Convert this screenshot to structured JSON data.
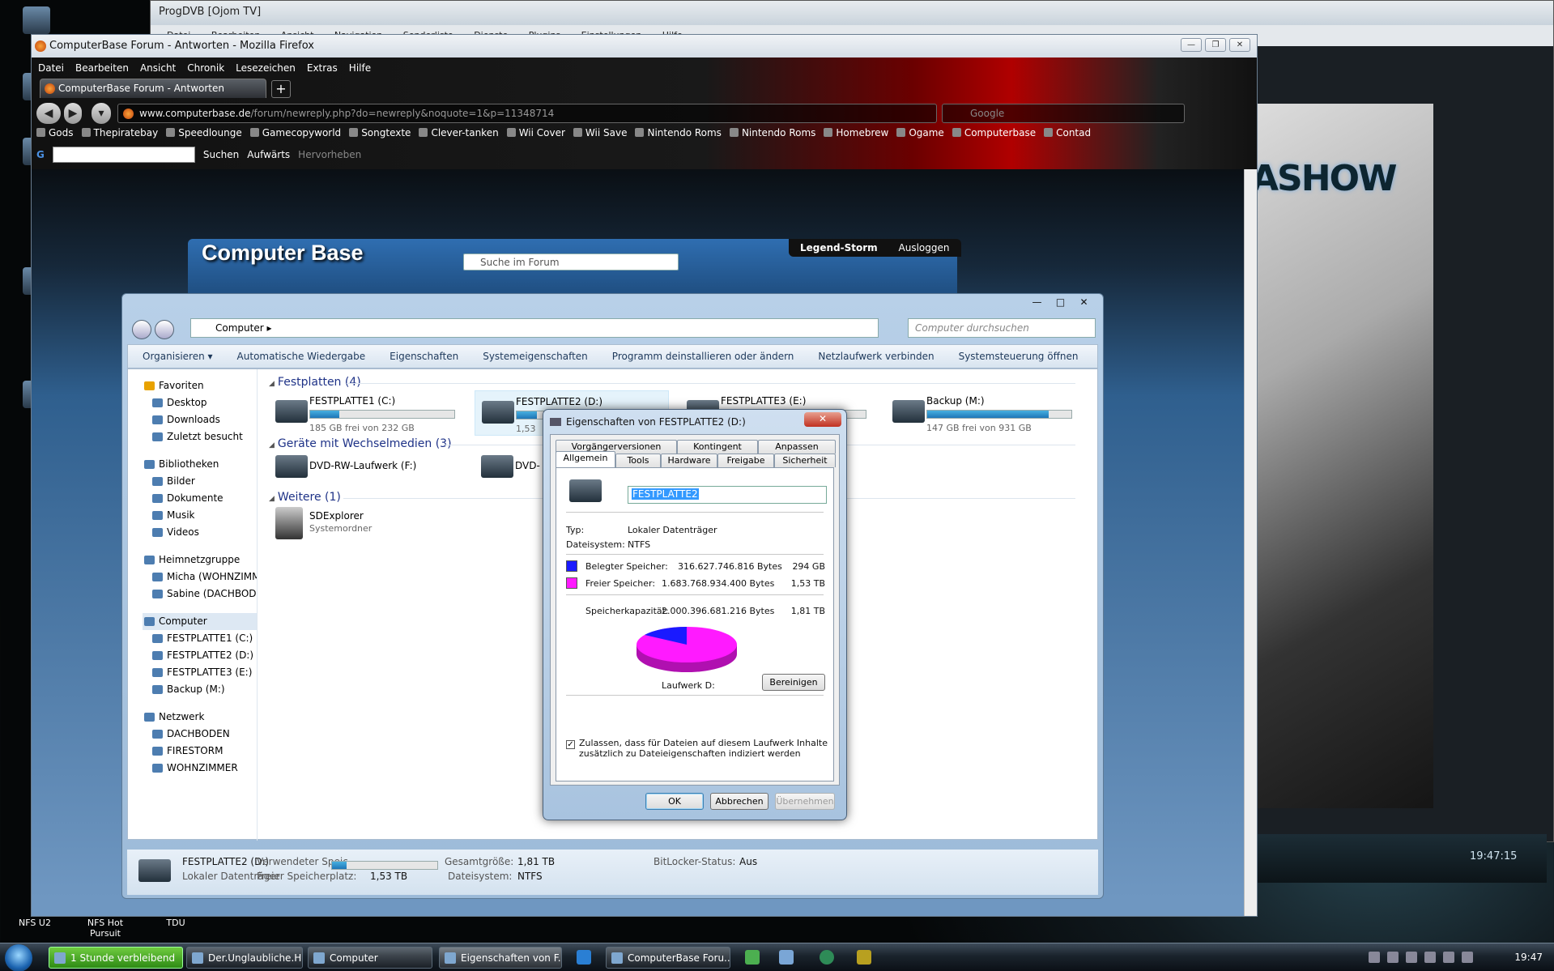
{
  "desktop": {
    "bottom_labels": [
      "NFS U2",
      "NFS Hot Pursuit",
      "TDU"
    ]
  },
  "progdvb": {
    "title": "ProgDVB [Ojom TV]",
    "menu": [
      "Datei",
      "Bearbeiten",
      "Ansicht",
      "Navigation",
      "Senderliste",
      "Dienste",
      "Plugins",
      "Einstellungen",
      "Hilfe"
    ],
    "video_text": "ASHOW",
    "time": "19:47:15"
  },
  "firefox": {
    "title": "ComputerBase Forum - Antworten - Mozilla Firefox",
    "menu": [
      "Datei",
      "Bearbeiten",
      "Ansicht",
      "Chronik",
      "Lesezeichen",
      "Extras",
      "Hilfe"
    ],
    "tab_label": "ComputerBase Forum - Antworten",
    "new_tab": "+",
    "url_domain": "www.computerbase.de",
    "url_path": "/forum/newreply.php?do=newreply&noquote=1&p=11348714",
    "search_placeholder": "Google",
    "bookmarks": [
      "Gods",
      "Thepiratebay",
      "Speedlounge",
      "Gamecopyworld",
      "Songtexte",
      "Clever-tanken",
      "Wii Cover",
      "Wii Save",
      "Nintendo Roms",
      "Nintendo Roms",
      "Homebrew",
      "Ogame",
      "Computerbase",
      "Contad"
    ],
    "google_bar": {
      "search": "Suchen",
      "up": "Aufwärts",
      "highlight": "Hervorheben"
    }
  },
  "computerbase": {
    "logo": "Computer Base",
    "search_placeholder": "Suche im Forum",
    "user": "Legend-Storm",
    "logout": "Ausloggen"
  },
  "explorer": {
    "breadcrumb": "Computer",
    "search_placeholder": "Computer durchsuchen",
    "commands": [
      "Organisieren ▾",
      "Automatische Wiedergabe",
      "Eigenschaften",
      "Systemeigenschaften",
      "Programm deinstallieren oder ändern",
      "Netzlaufwerk verbinden",
      "Systemsteuerung öffnen"
    ],
    "nav": {
      "favorites": "Favoriten",
      "fav_items": [
        "Desktop",
        "Downloads",
        "Zuletzt besucht"
      ],
      "libraries": "Bibliotheken",
      "lib_items": [
        "Bilder",
        "Dokumente",
        "Musik",
        "Videos"
      ],
      "homegroup": "Heimnetzgruppe",
      "home_items": [
        "Micha (WOHNZIMMER)",
        "Sabine (DACHBODEN)"
      ],
      "computer": "Computer",
      "comp_items": [
        "FESTPLATTE1 (C:)",
        "FESTPLATTE2 (D:)",
        "FESTPLATTE3 (E:)",
        "Backup (M:)"
      ],
      "network": "Netzwerk",
      "net_items": [
        "DACHBODEN",
        "FIRESTORM",
        "WOHNZIMMER"
      ]
    },
    "groups": {
      "hdd": "Festplatten (4)",
      "removable": "Geräte mit Wechselmedien (3)",
      "other": "Weitere (1)"
    },
    "drives": [
      {
        "name": "FESTPLATTE1 (C:)",
        "free": "185 GB frei von 232 GB",
        "used_fraction": 0.2
      },
      {
        "name": "FESTPLATTE2 (D:)",
        "free": "1,53",
        "used_fraction": 0.14
      },
      {
        "name": "FESTPLATTE3 (E:)",
        "free": "",
        "used_fraction": 0.6
      },
      {
        "name": "Backup (M:)",
        "free": "147 GB frei von 931 GB",
        "used_fraction": 0.84
      }
    ],
    "removable": [
      "DVD-RW-Laufwerk (F:)",
      "DVD-"
    ],
    "other": {
      "name": "SDExplorer",
      "type": "Systemordner"
    },
    "status": {
      "name": "FESTPLATTE2 (D:)",
      "type": "Lokaler Datenträger",
      "used_label": "Verwendeter Speic...",
      "used_fraction": 0.14,
      "free_label": "Freier Speicherplatz:",
      "free_value": "1,53 TB",
      "total_label": "Gesamtgröße:",
      "total_value": "1,81 TB",
      "fs_label": "Dateisystem:",
      "fs_value": "NTFS",
      "bitlocker_label": "BitLocker-Status:",
      "bitlocker_value": "Aus"
    }
  },
  "dialog": {
    "title": "Eigenschaften von FESTPLATTE2 (D:)",
    "close": "✕",
    "tabs_row1": [
      "Vorgängerversionen",
      "Kontingent",
      "Anpassen"
    ],
    "tabs_row2": [
      "Allgemein",
      "Tools",
      "Hardware",
      "Freigabe",
      "Sicherheit"
    ],
    "name_value": "FESTPLATTE2",
    "type_label": "Typ:",
    "type_value": "Lokaler Datenträger",
    "fs_label": "Dateisystem:",
    "fs_value": "NTFS",
    "used_label": "Belegter Speicher:",
    "used_bytes": "316.627.746.816 Bytes",
    "used_size": "294 GB",
    "free_label": "Freier Speicher:",
    "free_bytes": "1.683.768.934.400 Bytes",
    "free_size": "1,53 TB",
    "cap_label": "Speicherkapazität:",
    "cap_bytes": "2.000.396.681.216 Bytes",
    "cap_size": "1,81 TB",
    "drive_label": "Laufwerk D:",
    "cleanup": "Bereinigen",
    "index_line1": "Zulassen, dass für Dateien auf diesem Laufwerk Inhalte",
    "index_line2": "zusätzlich zu Dateieigenschaften indiziert werden",
    "index_checked": true,
    "ok": "OK",
    "cancel": "Abbrechen",
    "apply": "Übernehmen",
    "colors": {
      "used": "#1a1aff",
      "free": "#ff1aff"
    }
  },
  "taskbar": {
    "items": [
      "1 Stunde verbleibend",
      "Der.Unglaubliche.Hu...",
      "Computer",
      "Eigenschaften von F...",
      "ComputerBase Foru..."
    ],
    "clock": "19:47"
  }
}
